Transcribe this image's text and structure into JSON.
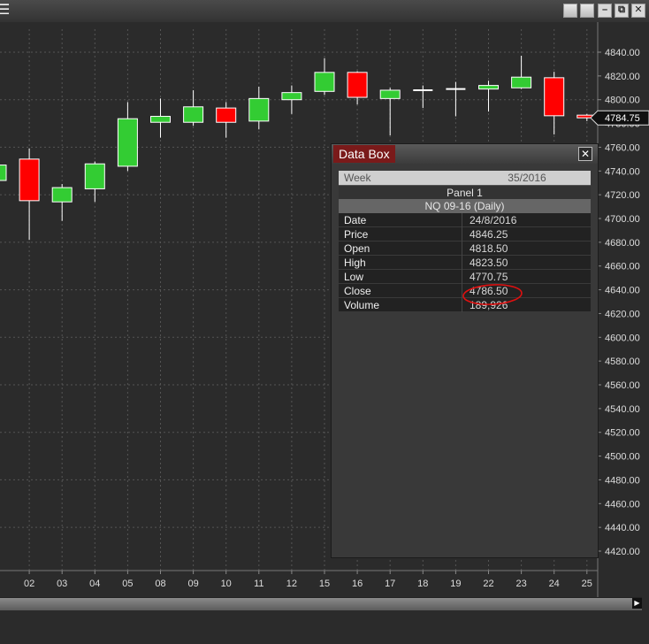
{
  "window": {
    "menu_icon": "hamburger-icon",
    "buttons": [
      "restore-icon",
      "restore-icon",
      "minimize-icon",
      "maximize-icon",
      "close-icon"
    ],
    "minimize_glyph": "–",
    "maximize_glyph": "⧉",
    "close_glyph": "✕"
  },
  "chart_data": {
    "type": "candlestick",
    "title": "",
    "categories": [
      "02",
      "03",
      "04",
      "05",
      "08",
      "09",
      "10",
      "11",
      "12",
      "15",
      "16",
      "17",
      "18",
      "19",
      "22",
      "23",
      "24",
      "25"
    ],
    "candles": [
      {
        "label": "",
        "open": 4732,
        "high": 4748,
        "low": 4720,
        "close": 4745
      },
      {
        "label": "02",
        "open": 4750,
        "high": 4759,
        "low": 4682,
        "close": 4715
      },
      {
        "label": "03",
        "open": 4714,
        "high": 4729,
        "low": 4698,
        "close": 4726
      },
      {
        "label": "04",
        "open": 4725,
        "high": 4748,
        "low": 4714,
        "close": 4746
      },
      {
        "label": "05",
        "open": 4744,
        "high": 4798,
        "low": 4740,
        "close": 4784
      },
      {
        "label": "08",
        "open": 4781,
        "high": 4801,
        "low": 4768,
        "close": 4786
      },
      {
        "label": "09",
        "open": 4781,
        "high": 4808,
        "low": 4778,
        "close": 4794
      },
      {
        "label": "10",
        "open": 4793,
        "high": 4798,
        "low": 4768,
        "close": 4781
      },
      {
        "label": "11",
        "open": 4782,
        "high": 4811,
        "low": 4775,
        "close": 4801
      },
      {
        "label": "12",
        "open": 4800,
        "high": 4812,
        "low": 4788,
        "close": 4806
      },
      {
        "label": "15",
        "open": 4807,
        "high": 4835,
        "low": 4804,
        "close": 4823
      },
      {
        "label": "16",
        "open": 4823,
        "high": 4824,
        "low": 4796,
        "close": 4802
      },
      {
        "label": "17",
        "open": 4801,
        "high": 4810,
        "low": 4770,
        "close": 4808
      },
      {
        "label": "18",
        "open": 4808,
        "high": 4812,
        "low": 4793,
        "close": 4808
      },
      {
        "label": "19",
        "open": 4809,
        "high": 4815,
        "low": 4786,
        "close": 4809
      },
      {
        "label": "22",
        "open": 4809,
        "high": 4816,
        "low": 4790,
        "close": 4812
      },
      {
        "label": "23",
        "open": 4810,
        "high": 4837,
        "low": 4809,
        "close": 4819
      },
      {
        "label": "24",
        "open": 4818.5,
        "high": 4823.5,
        "low": 4770.75,
        "close": 4786.5
      },
      {
        "label": "25",
        "open": 4787,
        "high": 4788,
        "low": 4782,
        "close": 4784.75
      }
    ],
    "ylim": [
      4410,
      4850
    ],
    "y_ticks": [
      "4840.00",
      "4820.00",
      "4800.00",
      "4780.00",
      "4760.00",
      "4740.00",
      "4720.00",
      "4700.00",
      "4680.00",
      "4660.00",
      "4640.00",
      "4620.00",
      "4600.00",
      "4580.00",
      "4560.00",
      "4540.00",
      "4520.00",
      "4500.00",
      "4480.00",
      "4460.00",
      "4440.00",
      "4420.00"
    ],
    "last_price": "4784.75",
    "grid": true,
    "colors": {
      "up": "#33cc33",
      "down": "#ff0000",
      "flat": "#ffffff",
      "background": "#2b2b2b",
      "grid": "#555555"
    }
  },
  "databox": {
    "title": "Data Box",
    "close_icon": "close-icon",
    "close_glyph": "✕",
    "week_label": "Week",
    "week_value": "35/2016",
    "panel": "Panel 1",
    "instrument": "NQ 09-16 (Daily)",
    "fields": [
      {
        "label": "Date",
        "value": "24/8/2016"
      },
      {
        "label": "Price",
        "value": "4846.25"
      },
      {
        "label": "Open",
        "value": "4818.50"
      },
      {
        "label": "High",
        "value": "4823.50"
      },
      {
        "label": "Low",
        "value": "4770.75"
      },
      {
        "label": "Close",
        "value": "4786.50"
      },
      {
        "label": "Volume",
        "value": "189,926"
      }
    ],
    "highlight_color": "#e01010"
  }
}
